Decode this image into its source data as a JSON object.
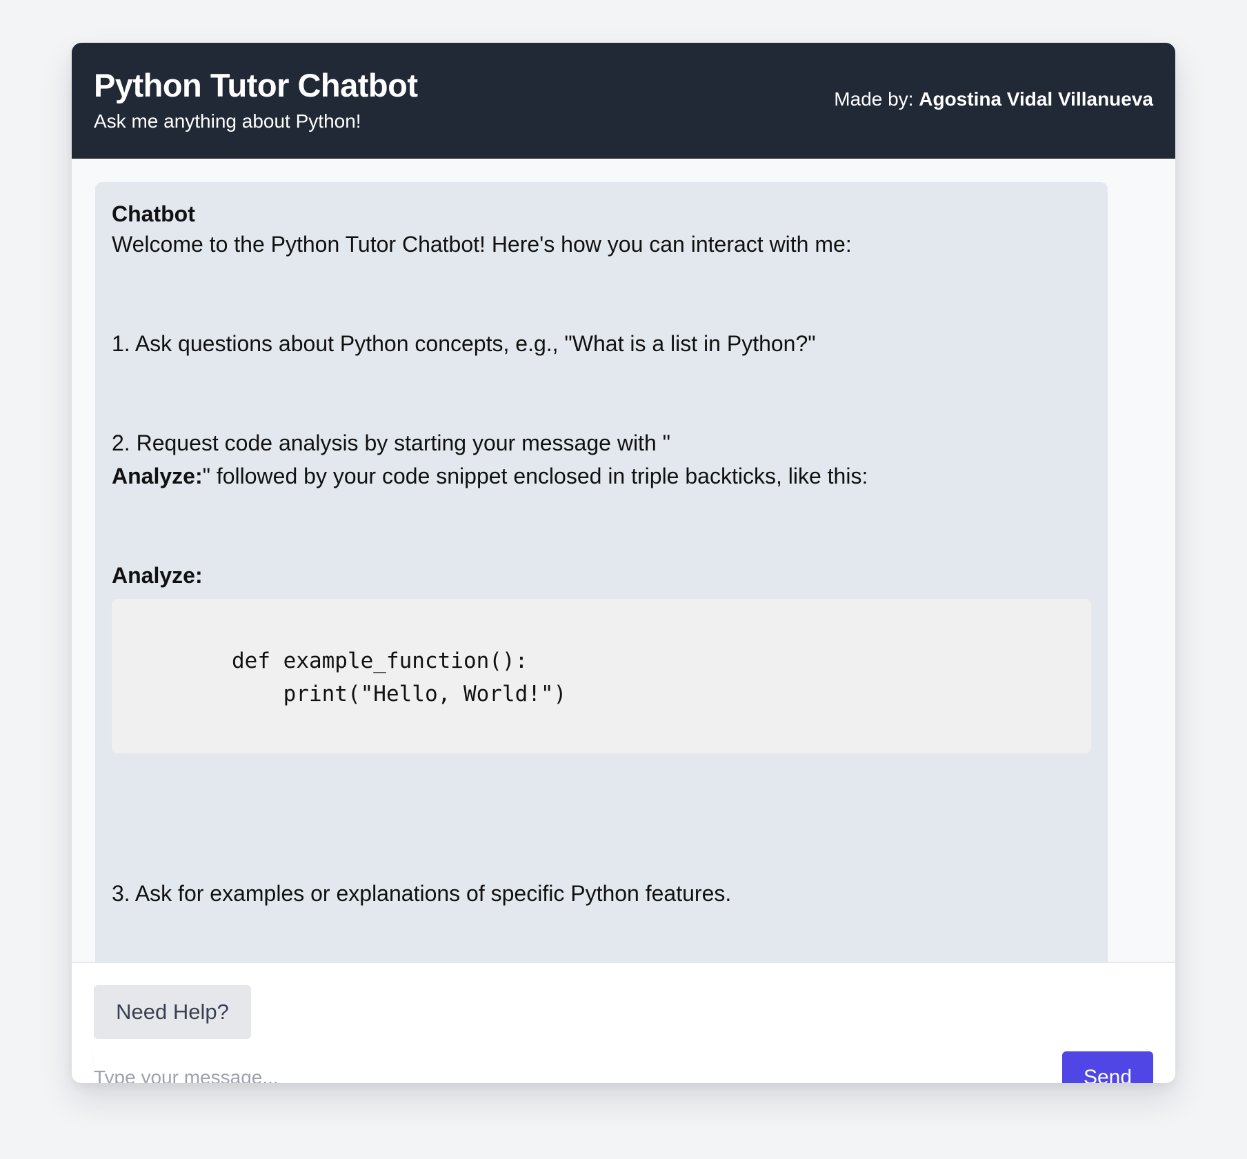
{
  "header": {
    "title": "Python Tutor Chatbot",
    "subtitle": "Ask me anything about Python!",
    "credit_prefix": "Made by: ",
    "author": "Agostina Vidal Villanueva"
  },
  "chat": {
    "message": {
      "sender": "Chatbot",
      "intro": "Welcome to the Python Tutor Chatbot! Here's how you can interact with me:",
      "item_1": "1. Ask questions about Python concepts, e.g., \"What is a list in Python?\"",
      "item_2_line_1": "2. Request code analysis by starting your message with \"",
      "item_2_bold": "Analyze:",
      "item_2_line_2": "\" followed by your code snippet enclosed in triple backticks, like this:",
      "example_label": "Analyze:",
      "code": "def example_function():\n    print(\"Hello, World!\")",
      "item_3": "3. Ask for examples or explanations of specific Python features."
    }
  },
  "controls": {
    "help_label": "Need Help?",
    "input_placeholder": "Type your message...",
    "send_label": "Send"
  },
  "colors": {
    "page_background": "#f3f4f6",
    "header_background": "#212836",
    "message_background": "#e3e7ee",
    "code_background": "#f0f0f0",
    "send_button": "#4f46e5"
  }
}
